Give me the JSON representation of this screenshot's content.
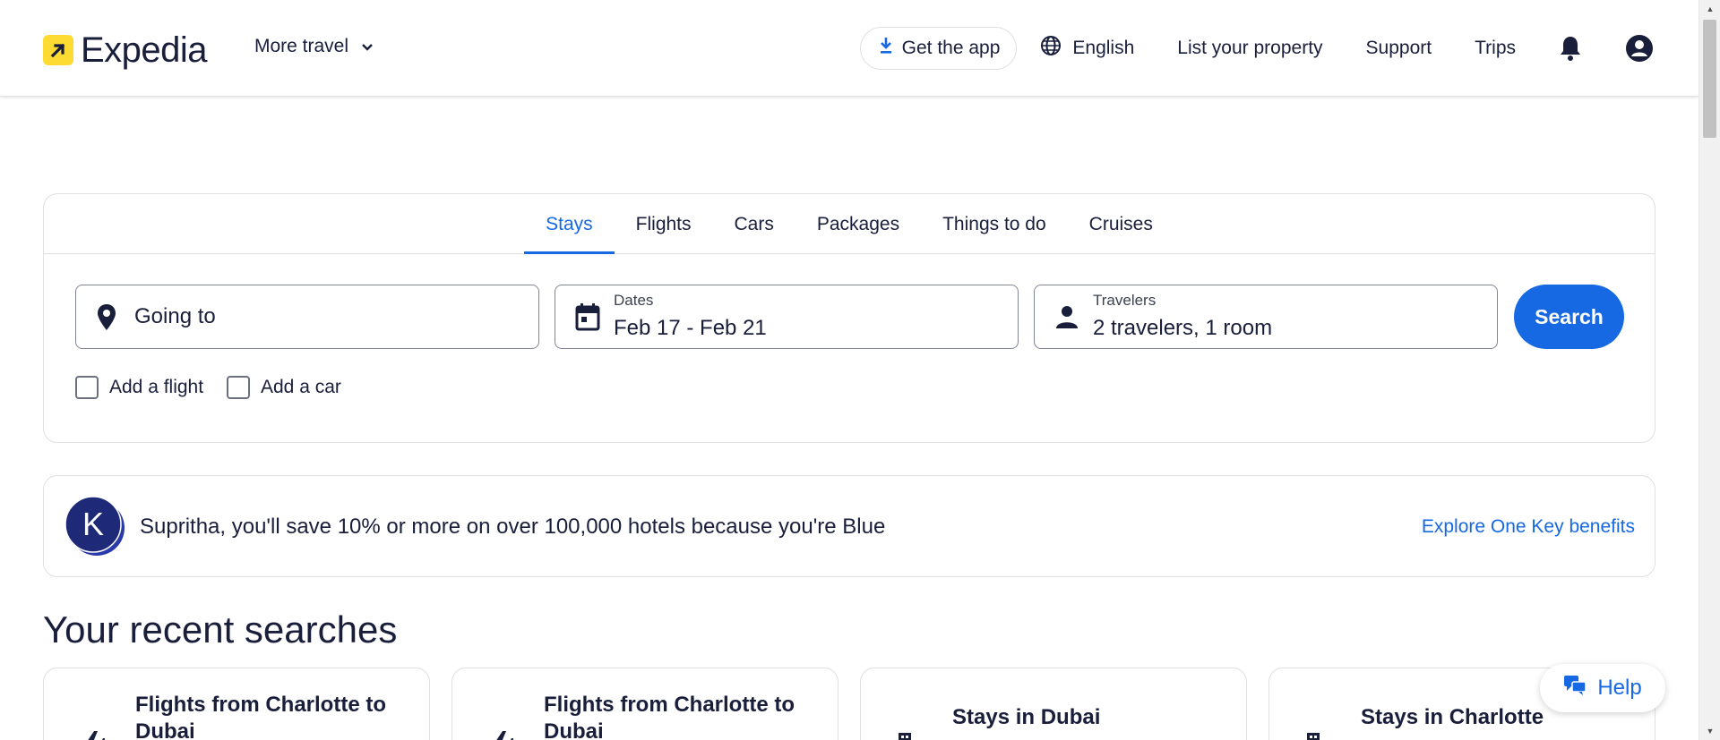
{
  "header": {
    "logo_text": "Expedia",
    "more_travel_label": "More travel",
    "get_app_label": "Get the app",
    "language_label": "English",
    "list_property_label": "List your property",
    "support_label": "Support",
    "trips_label": "Trips"
  },
  "search": {
    "tabs": [
      {
        "label": "Stays",
        "active": true
      },
      {
        "label": "Flights",
        "active": false
      },
      {
        "label": "Cars",
        "active": false
      },
      {
        "label": "Packages",
        "active": false
      },
      {
        "label": "Things to do",
        "active": false
      },
      {
        "label": "Cruises",
        "active": false
      }
    ],
    "destination_placeholder": "Going to",
    "dates_label": "Dates",
    "dates_value": "Feb 17 - Feb 21",
    "travelers_label": "Travelers",
    "travelers_value": "2 travelers, 1 room",
    "search_button": "Search",
    "add_flight_label": "Add a flight",
    "add_car_label": "Add a car"
  },
  "promo": {
    "badge_letter": "K",
    "message": "Supritha, you'll save 10% or more on over 100,000 hotels because you're Blue",
    "link_label": "Explore One Key benefits"
  },
  "recent": {
    "title": "Your recent searches",
    "cards": [
      {
        "title": "Flights from Charlotte to Dubai",
        "icon": "plane-icon"
      },
      {
        "title": "Flights from Charlotte to Dubai",
        "icon": "plane-icon"
      },
      {
        "title": "Stays in Dubai",
        "icon": "building-icon"
      },
      {
        "title": "Stays in Charlotte",
        "icon": "building-icon"
      }
    ]
  },
  "help": {
    "label": "Help"
  },
  "colors": {
    "accent": "#1668e3",
    "brand_yellow": "#fddb32",
    "text": "#191e3b",
    "onekey_navy": "#1e2a78"
  }
}
